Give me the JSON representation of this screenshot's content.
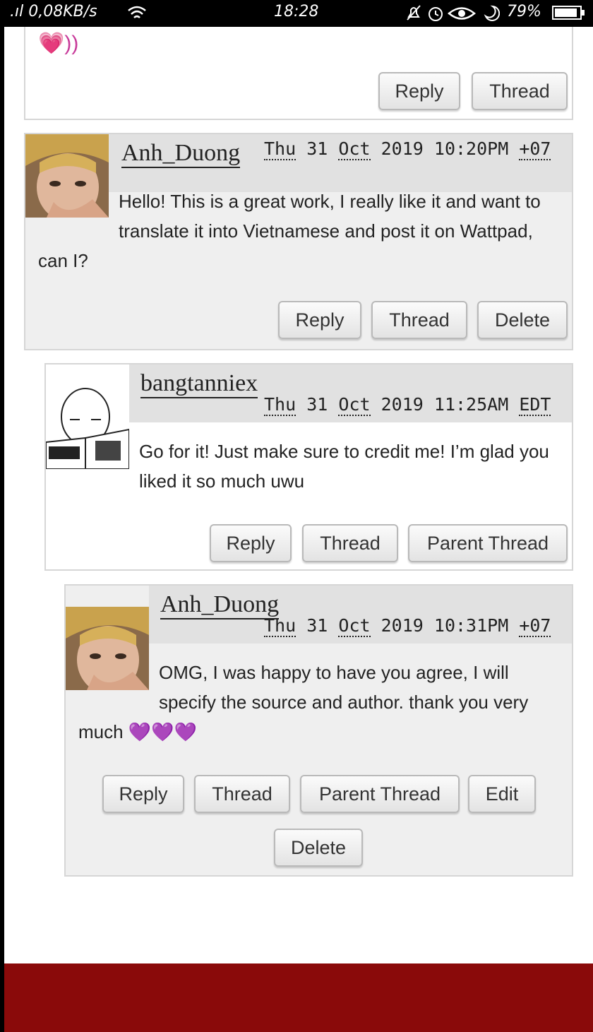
{
  "status_bar": {
    "network_speed": ".ıl 0,08KB/s",
    "time": "18:28",
    "battery": "79%",
    "icons": [
      "signal-icon",
      "wifi-icon",
      "mute-icon",
      "alarm-icon",
      "eye-icon",
      "moon-icon",
      "battery-icon"
    ]
  },
  "top_comment": {
    "body_fragment": "💗))",
    "buttons": {
      "reply": "Reply",
      "thread": "Thread"
    }
  },
  "comments": [
    {
      "username": "Anh_Duong",
      "date_day": "Thu",
      "date_num": "31",
      "date_month": "Oct",
      "date_year": "2019",
      "time": "10:20PM",
      "tz": "+07",
      "body": "Hello! This is a great work, I really like it and want to translate it into Vietnamese and post it on Wattpad, can I?",
      "buttons": {
        "reply": "Reply",
        "thread": "Thread",
        "delete": "Delete"
      }
    },
    {
      "username": "bangtanniex",
      "date_day": "Thu",
      "date_num": "31",
      "date_month": "Oct",
      "date_year": "2019",
      "time": "11:25AM",
      "tz": "EDT",
      "body": "Go for it! Just make sure to credit me! I’m glad you liked it so much uwu",
      "buttons": {
        "reply": "Reply",
        "thread": "Thread",
        "parent_thread": "Parent Thread"
      }
    },
    {
      "username": "Anh_Duong",
      "date_day": "Thu",
      "date_num": "31",
      "date_month": "Oct",
      "date_year": "2019",
      "time": "10:31PM",
      "tz": "+07",
      "body": "OMG, I was happy to have you agree, I will specify the source and author. thank you very much 💜💜💜",
      "buttons": {
        "reply": "Reply",
        "thread": "Thread",
        "parent_thread": "Parent Thread",
        "edit": "Edit",
        "delete": "Delete"
      }
    }
  ],
  "colors": {
    "footer": "#8a0a0a",
    "comment_bg": "#efefef",
    "header_bg": "#e1e1e1"
  }
}
